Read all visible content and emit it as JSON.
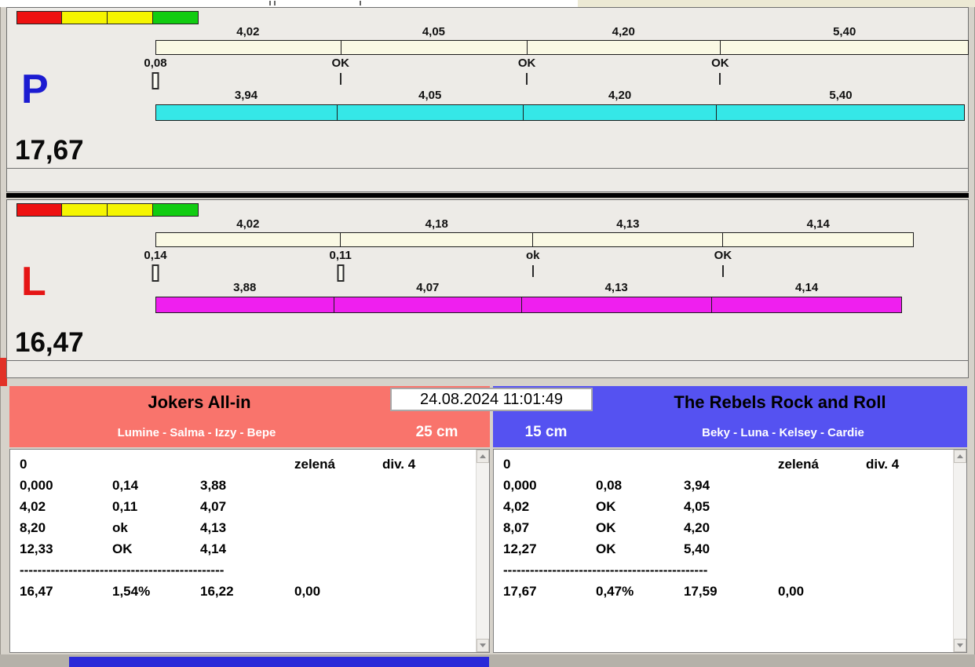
{
  "lanes": [
    {
      "letter": "P",
      "letter_color": "#1b1bd1",
      "total_label": "17,67",
      "traffic_blocks": [
        "#ee1111",
        "#f5f500",
        "#f5f500",
        "#11cc11"
      ],
      "split_bar": {
        "color": "#faf9e4",
        "labels": [
          "4,02",
          "4,05",
          "4,20",
          "5,40"
        ],
        "values": [
          4.02,
          4.05,
          4.2,
          5.4
        ]
      },
      "run_bar": {
        "color": "#35e7e7",
        "labels": [
          "3,94",
          "4,05",
          "4,20",
          "5,40"
        ],
        "values": [
          3.94,
          4.05,
          4.2,
          5.4
        ]
      },
      "markers": [
        {
          "label": "0,08",
          "style": "box"
        },
        {
          "label": "OK",
          "style": "tick"
        },
        {
          "label": "OK",
          "style": "tick"
        },
        {
          "label": "OK",
          "style": "tick"
        }
      ]
    },
    {
      "letter": "L",
      "letter_color": "#e51515",
      "total_label": "16,47",
      "traffic_blocks": [
        "#ee1111",
        "#f5f500",
        "#f5f500",
        "#11cc11"
      ],
      "split_bar": {
        "color": "#faf9e4",
        "labels": [
          "4,02",
          "4,18",
          "4,13",
          "4,14"
        ],
        "values": [
          4.02,
          4.18,
          4.13,
          4.14
        ]
      },
      "run_bar": {
        "color": "#ef1fef",
        "labels": [
          "3,88",
          "4,07",
          "4,13",
          "4,14"
        ],
        "values": [
          3.88,
          4.07,
          4.13,
          4.14
        ]
      },
      "markers": [
        {
          "label": "0,14",
          "style": "box"
        },
        {
          "label": "0,11",
          "style": "box"
        },
        {
          "label": "ok",
          "style": "tick"
        },
        {
          "label": "OK",
          "style": "tick"
        }
      ]
    }
  ],
  "timestamp": "24.08.2024 11:01:49",
  "teams": [
    {
      "name": "Jokers All-in",
      "members": "Lumine - Salma - Izzy - Bepe",
      "height": "25 cm",
      "header_bg": "#f9746c",
      "result": {
        "head": {
          "start": "0",
          "color_label": "zelená",
          "division": "div. 4"
        },
        "rows": [
          [
            "0,000",
            "0,14",
            "3,88"
          ],
          [
            "4,02",
            "0,11",
            "4,07"
          ],
          [
            "8,20",
            "ok",
            "4,13"
          ],
          [
            "12,33",
            "OK",
            "4,14"
          ]
        ],
        "separator": "----------------------------------------------",
        "summary": [
          "16,47",
          "1,54%",
          "16,22",
          "0,00"
        ]
      }
    },
    {
      "name": "The Rebels Rock and Roll",
      "members": "Beky - Luna - Kelsey - Cardie",
      "height": "15 cm",
      "header_bg": "#5552f1",
      "result": {
        "head": {
          "start": "0",
          "color_label": "zelená",
          "division": "div. 4"
        },
        "rows": [
          [
            "0,000",
            "0,08",
            "3,94"
          ],
          [
            "4,02",
            "OK",
            "4,05"
          ],
          [
            "8,07",
            "OK",
            "4,20"
          ],
          [
            "12,27",
            "OK",
            "5,40"
          ]
        ],
        "separator": "----------------------------------------------",
        "summary": [
          "17,67",
          "0,47%",
          "17,59",
          "0,00"
        ]
      }
    }
  ]
}
